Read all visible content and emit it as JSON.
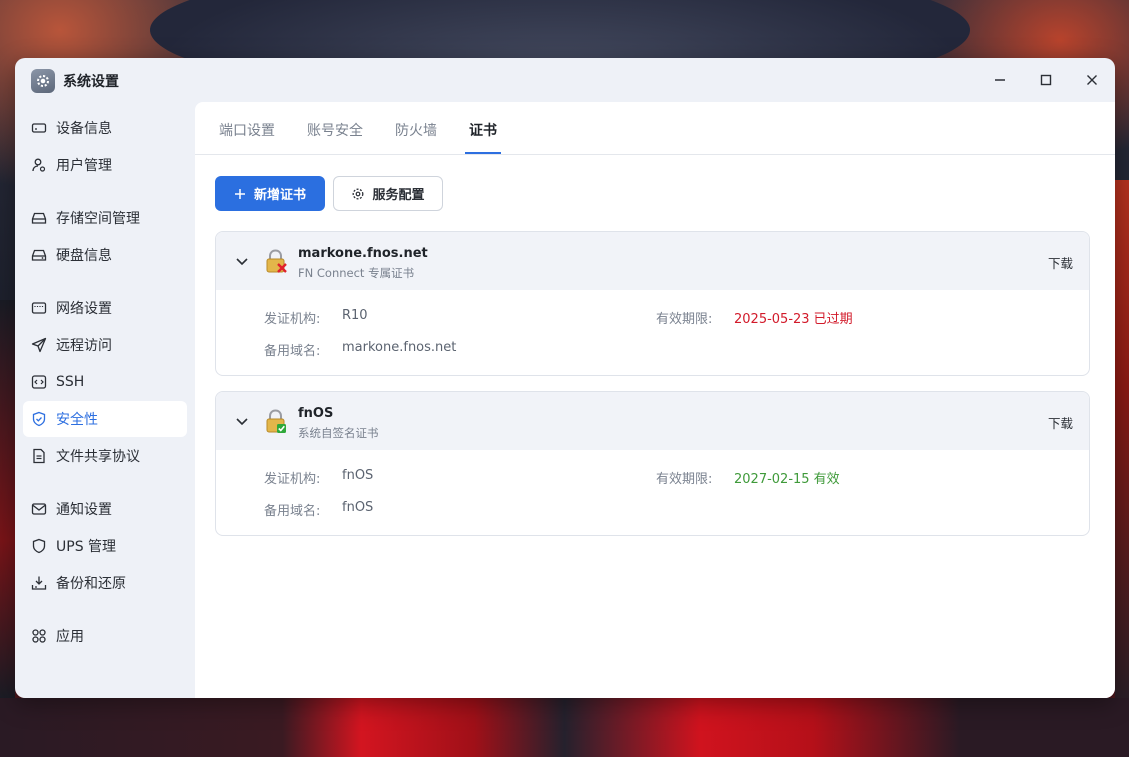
{
  "window": {
    "title": "系统设置"
  },
  "sidebar": {
    "items": [
      {
        "label": "设备信息",
        "icon": "device-icon"
      },
      {
        "label": "用户管理",
        "icon": "users-icon"
      },
      {
        "label": "存储空间管理",
        "icon": "storage-icon"
      },
      {
        "label": "硬盘信息",
        "icon": "disk-icon"
      },
      {
        "label": "网络设置",
        "icon": "network-icon"
      },
      {
        "label": "远程访问",
        "icon": "send-icon"
      },
      {
        "label": "SSH",
        "icon": "ssh-icon"
      },
      {
        "label": "安全性",
        "icon": "shield-check-icon",
        "active": true
      },
      {
        "label": "文件共享协议",
        "icon": "file-icon"
      },
      {
        "label": "通知设置",
        "icon": "mail-icon"
      },
      {
        "label": "UPS 管理",
        "icon": "shield-icon"
      },
      {
        "label": "备份和还原",
        "icon": "backup-icon"
      },
      {
        "label": "应用",
        "icon": "apps-icon"
      }
    ]
  },
  "tabs": [
    {
      "label": "端口设置"
    },
    {
      "label": "账号安全"
    },
    {
      "label": "防火墙"
    },
    {
      "label": "证书",
      "active": true
    }
  ],
  "toolbar": {
    "add_label": "新增证书",
    "config_label": "服务配置"
  },
  "certificates": [
    {
      "name": "markone.fnos.net",
      "subtitle": "FN Connect 专属证书",
      "download": "下载",
      "issuer_label": "发证机构:",
      "issuer": "R10",
      "validity_label": "有效期限:",
      "validity": "2025-05-23 已过期",
      "alt_label": "备用域名:",
      "alt": "markone.fnos.net",
      "status": "expired",
      "status_color": "#d21a2a"
    },
    {
      "name": "fnOS",
      "subtitle": "系统自签名证书",
      "download": "下载",
      "issuer_label": "发证机构:",
      "issuer": "fnOS",
      "validity_label": "有效期限:",
      "validity": "2027-02-15 有效",
      "alt_label": "备用域名:",
      "alt": "fnOS",
      "status": "valid",
      "status_color": "#3f9a3a"
    }
  ],
  "colors": {
    "accent": "#2b6fe0",
    "sidebar_bg": "#eef1f7"
  }
}
